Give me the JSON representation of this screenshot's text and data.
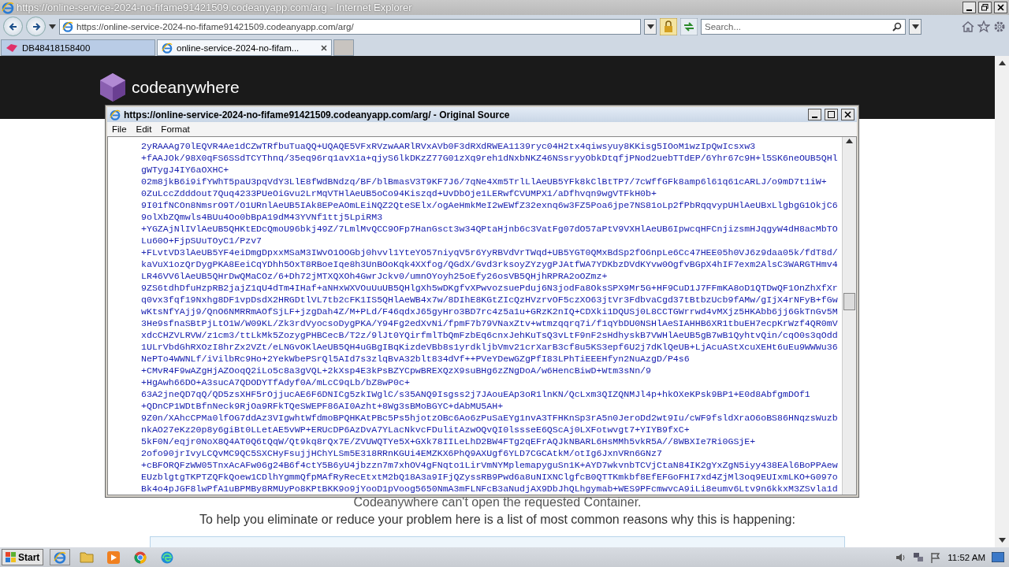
{
  "browser": {
    "title": "https://online-service-2024-no-fifame91421509.codeanyapp.com/arg - Internet Explorer",
    "address": "https://online-service-2024-no-fifame91421509.codeanyapp.com/arg/",
    "search_placeholder": "Search...",
    "tabs": [
      {
        "label": "DB48418158400",
        "selected": false
      },
      {
        "label": "online-service-2024-no-fifam...",
        "selected": true
      }
    ]
  },
  "page": {
    "logo_text": "codeanywhere",
    "message": "Codeanywhere can't open the requested Container.",
    "help_text": "To help you eliminate or reduce your problem here is a list of most common reasons why this is happening:"
  },
  "source_window": {
    "title": "https://online-service-2024-no-fifame91421509.codeanyapp.com/arg/ - Original Source",
    "menu": [
      "File",
      "Edit",
      "Format"
    ],
    "lines": [
      "2yRAAAg70lEQVR4Ae1dCZwTRfbuTuaQQ+UQAQE5VFxRVzwAARlRVxAVb0F3dRXdRWEA1139ryc04H2tx4qiwsyuy8KKisg5IOoM1wzIpQwIcsxw3",
      "+fAAJOk/98X0qFS6SSdTCYThnq/35eq96rq1avX1a+qjyS6lkDKzZ77G01zXq9reh1dNxbNKZ46NSsryyObkDtqfjPNod2uebTTdEP/6Yhr67c9H+l5SK6neOUB5QHl",
      "gWTygJ4IY6aOXHC+",
      "02m8jkB6i9ifYWhT5paU3pqVdY3LlE8fWdBNdzq/BF/blBmasV3T9KF7J6/7qNe4Xm5TrlLlAeUB5YFk8kClBtTP7/7cWffGFk8amp6l61q61cARLJ/o9mD7t1iW+",
      "0ZuLccZdddout7Quq4233PUeOiGvu2LrMqVTHlAeUB5oCo94Kiszqd+UvDbOje1LERwfCVUMPX1/aDfhvqn9wgVTFkH0b+",
      "9I01fNCOn8NmsrO9T/O1URnlAeUB5IAk8EPeAOmLEiNQZ2QteSElx/ogAeHmkMeI2wEWfZ32exnq6w3FZ5Poa6jpe7NS81oLp2fPbRqqvypUHlAeUBxLlgbgG1OkjC6",
      "9olXbZQmwls4BUu4Oo0bBpA19dM43YVNf1ttj5LpiRM3",
      "+YGZAjNlIVlAeUB5QHKtEDcQmoU96bkj49Z/7LmlMvQCC9OFp7HanGsct3w34QPtaHjnb6c3VatFg07dO57aPtV9VXHlAeUB6IpwcqHFCnjizsmHJqgyW4dH8acMbTO",
      "Lu60O+FjpSUuTOyC1/Pzv7",
      "+FLvtVD3lAeUB5YF4eiDmgDpxxMSaM3IWvO1OOGbj0hvvl1YteYO57niyqV5r6YyRBVdVrTWqd+UB5YGT0QMxBdSp2fO6npLe6Cc47HEE05h0VJ6z9daa05k/fdT8d/",
      "kaVuX1ozQrDygPKA8EeiCqYDhh5OxT8RBoeIqe8h3UnBOoKqk4XXfog/QGdX/Gvd3rksoyZYzygPJAtfWA7YDKbzDVdKYvw0OgfvBGpX4hIF7exm2AlsC3WARGTHmv4",
      "LR46VV6lAeUB5QHrDwQMaCOz/6+Dh72jMTXQXOh4GwrJckv0/umnOYoyh25oEfy26osVB5QHjhRPRA2oOZmz+",
      "9ZS6tdhDfuHzpRB2jajZ1qU4dTm4IHaf+aNHxWXVOuUuUB5QHlgXh5wDKgfvXPwvozsuePduj6N3jodFa8OksSPX9Mr5G+HF9CuD1J7FFmKA8oD1QTDwQF1OnZhXfXr",
      "q0vx3fqf19Nxhg8DF1vpDsdX2HRGDtlVL7tb2cFK1IS5QHlAeWB4x7w/8DIhE8KGtZIcQzHVzrvOF5czXO63jtVr3FdbvaCgd37tBtbzUcb9fAMw/gIjX4rNFyB+fGw",
      "wKtsNfYAjj9/QnO6NMRRmAOfSjLF+jzgDah4Z/M+PLd/F46qdxJ65gyHro3BD7rc4z5a1u+GRzK2nIQ+CDXki1DQUSj0L8CCTGWrrwd4vMXjz5HKAbb6jj6GkTnGv5M",
      "3He9sfnaSBtPjLtO1W/W09KL/Zk3rdVyocsoDygPKA/Y94Fg2edXvNi/fpmF7b79VNaxZtv+wtmzqqrq7i/f1qYbDU0NSHlAeSIAHHB6XR1tbuEH7ecpKrWzf4QR0mV",
      "xdcCHZVLRVW/z1cm3/ttLkMk5ZozygPHBCecB/T2z/9lJt0YQirfmlTbQmFzbEq6cnxJehKuTsQ3vLtF9nF2sHdhyskB7VWHlAeUB5gB7wB1QyhtvQin/cqO0s3qOdd",
      "1ULrVbdGhRXOzI8hrZx2VZt/eLNGvOKlAeUB5QH4uGBgIBqKizdeVBb8s1yrdkljbVmv21crXarB3cf8u5KS3epf6U2j7dKlQeUB+LjAcuAStXcuXEHt6uEu9WWWu36",
      "NePTo4WWNLf/iVilbRc9Ho+2YekWbePSrQl5AId7s3zlqBvA32blt834dVf++PVeYDewGZgPfI83LPhTiEEEHfyn2NuAzgD/P4s6",
      "+CMvR4F9wAZgHjAZOoqQ2iLo5c8a3gVQL+2kXsp4E3kPsBZYCpwBREXQzX9suBHg6zZNgDoA/w6HencBiwD+Wtm3sNn/9",
      "+HgAwh66DO+A3sucA7QDODYTfAdyf0A/mLcC9qLb/bZ8wP0c+",
      "63A2jneQD7qQ/QD5zsXHF5rOjjucAE6F6DNICg5zkIWglC/s35ANQ9Isgss2j7JAouEAp3oR1lnKN/QcLxm3QIZQNMJl4p+hkOXeKPsk9BP1+E0d8AbfgmDOf1",
      "+QDnCP1WDtBfnNeck9RjOa9RFkTQeSWEPF86AI0Azht+8Wg3sBMoBGYC+dAbMU5AH+",
      "9Z0n/XAhcCPMa0lfOG7ddAz3VIgwhtWfdmoBPQHKAtPBc5Ps5hjotzOBc6Ao6zPuSaEYg1nvA3TFHKnSp3rA5n0JeroDd2wt9Iu/cWF9fsldXraO6oBS86HNqzsWuzb",
      "nkAO27eKz20p8y6giBt0LLetAE5vWP+ERUcDP6AzDvA7YLacNkvcFDulitAzwOQvQI0lssseE6QScAj0LXFotwvgt7+YIYB9fxC+",
      "5kF0N/eqjr0NoX8Q4AT0Q6tQqW/Qt9kq8rQx7E/ZVUWQTYe5X+GXk78IILeLhD2BW4FTg2qEFrAQJkNBARL6HsMMh5vkR5A//8WBXIe7Ri0GSjE+",
      "2ofo90jrIvyLCQvMC9QC5SXCHyFsujjHChYLSm5E318RRnKGUi4EMZKX6PhQ9AXUgf6YLD7CGCAtkM/otIg6JxnVRn6GNz7",
      "+cBFORQFzWW05TnxAcAFw06g24B6f4ctY5B6yU4jbzzn7m7xhOV4gFNqto1LirVmNYMplemapyguSn1K+AYD7wkvnbTCVjCtaN84IK2gYxZgN5iyy438EAl6BoPPAew",
      "EUzblgtgTKPTZQFkQoew1CDlhYgmmQfpMAfRyRecEtxtM2bQ18A3a9IFjQZyssRB9Pwd6a8uNIXNClgfcB0QTTKmkbf8EfEFGoFHI7xd4ZjMl3oq9EUIxmLKO+G097o",
      "Bk4o4pJGF8lwPfA1uBPMBy8RMUyPo8KPtBKK9o9jYooD1pVoog5650NmA3mFLNFcB3aNudjAX9DbJhQLhgymab+WES9PFcmwvcA9iLi8eumv6Ltv9n6kkxM3ZSvla1d"
    ]
  },
  "taskbar": {
    "start_label": "Start",
    "clock": "11:52 AM"
  }
}
